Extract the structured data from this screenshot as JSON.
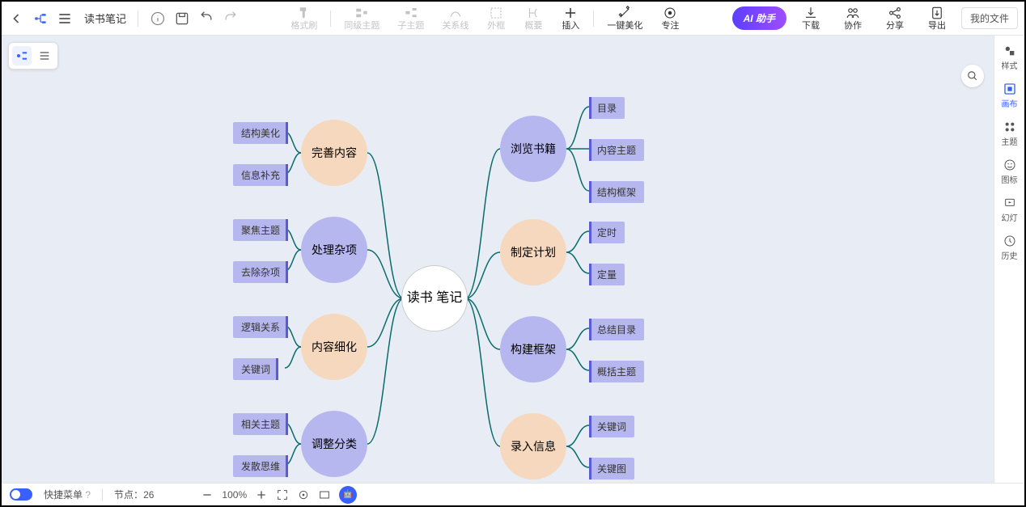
{
  "header": {
    "title": "读书笔记",
    "tools": {
      "format_brush": "格式刷",
      "peer_topic": "同级主题",
      "sub_topic": "子主题",
      "relation": "关系线",
      "outer_frame": "外框",
      "summary": "概要",
      "insert": "插入",
      "beautify": "一键美化",
      "focus": "专注"
    },
    "right": {
      "ai": "AI 助手",
      "download": "下载",
      "collab": "协作",
      "share": "分享",
      "export": "导出",
      "myfile": "我的文件"
    }
  },
  "sidebar": {
    "style": "样式",
    "canvas": "画布",
    "theme": "主题",
    "icon": "图标",
    "slide": "幻灯",
    "history": "历史"
  },
  "statusbar": {
    "quickmenu": "快捷菜单",
    "node_count_label": "节点：",
    "node_count": "26",
    "zoom": "100%"
  },
  "mindmap": {
    "center": "读书\n笔记",
    "left": [
      {
        "label": "完善内容",
        "color": "orange",
        "children": [
          "结构美化",
          "信息补充"
        ]
      },
      {
        "label": "处理杂项",
        "color": "purple",
        "children": [
          "聚焦主题",
          "去除杂项"
        ]
      },
      {
        "label": "内容细化",
        "color": "orange",
        "children": [
          "逻辑关系",
          "关键词"
        ]
      },
      {
        "label": "调整分类",
        "color": "purple",
        "children": [
          "相关主题",
          "发散思维"
        ]
      }
    ],
    "right": [
      {
        "label": "浏览书籍",
        "color": "purple",
        "children": [
          "目录",
          "内容主题",
          "结构框架"
        ]
      },
      {
        "label": "制定计划",
        "color": "orange",
        "children": [
          "定时",
          "定量"
        ]
      },
      {
        "label": "构建框架",
        "color": "purple",
        "children": [
          "总结目录",
          "概括主题"
        ]
      },
      {
        "label": "录入信息",
        "color": "orange",
        "children": [
          "关键词",
          "关键图"
        ]
      }
    ]
  }
}
